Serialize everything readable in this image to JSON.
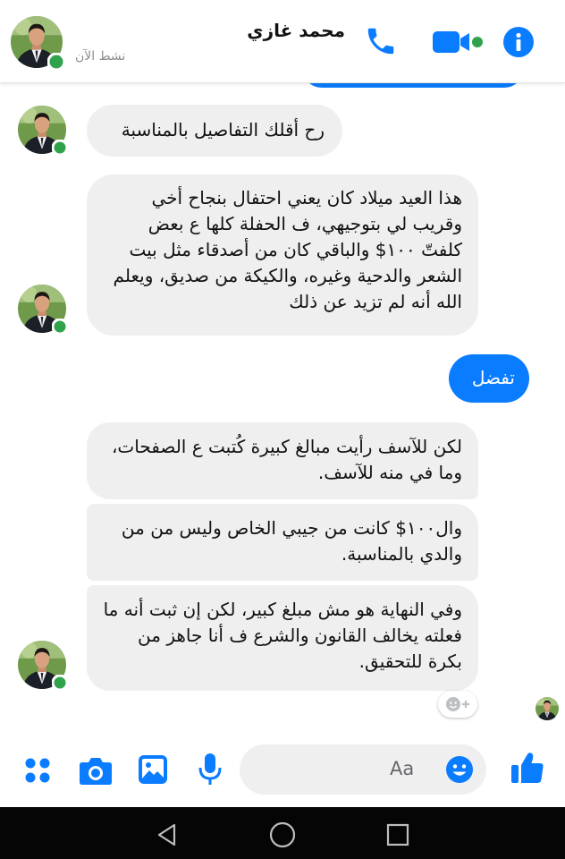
{
  "header": {
    "contact_name": "محمد غازي",
    "active_status": "نشط الآن"
  },
  "messages": [
    {
      "direction": "received",
      "text": "رح أقلك التفاصيل بالمناسبة"
    },
    {
      "direction": "received",
      "text": "هذا العيد ميلاد كان يعني احتفال بنجاح أخي وقريب لي بتوجيهي، ف الحفلة كلها ع بعض كلفتّ ١٠٠$ والباقي كان من أصدقاء مثل بيت الشعر والدحية وغيره، والكيكة من صديق، ويعلم الله أنه لم تزيد عن ذلك"
    },
    {
      "direction": "sent",
      "text": "تفضل"
    },
    {
      "direction": "received",
      "text": "لكن للآسف رأيت مبالغ كبيرة كُتبت ع الصفحات، وما في منه للآسف."
    },
    {
      "direction": "received",
      "text": "وال١٠٠$ كانت من جيبي الخاص وليس من من والدي بالمناسبة."
    },
    {
      "direction": "received",
      "text": "وفي النهاية هو مش مبلغ كبير، لكن إن ثبت أنه ما فعلته يخالف القانون والشرع ف أنا جاهز من بكرة للتحقيق."
    }
  ],
  "composer": {
    "placeholder": "Aa"
  },
  "colors": {
    "accent": "#0a7cff",
    "received_bubble": "#efefef",
    "online_dot": "#31a24c"
  },
  "icons": [
    "call-icon",
    "video-call-icon",
    "info-icon",
    "apps-icon",
    "camera-icon",
    "gallery-icon",
    "microphone-icon",
    "emoji-icon",
    "like-icon",
    "add-reaction-icon",
    "nav-back-icon",
    "nav-home-icon",
    "nav-recents-icon"
  ]
}
